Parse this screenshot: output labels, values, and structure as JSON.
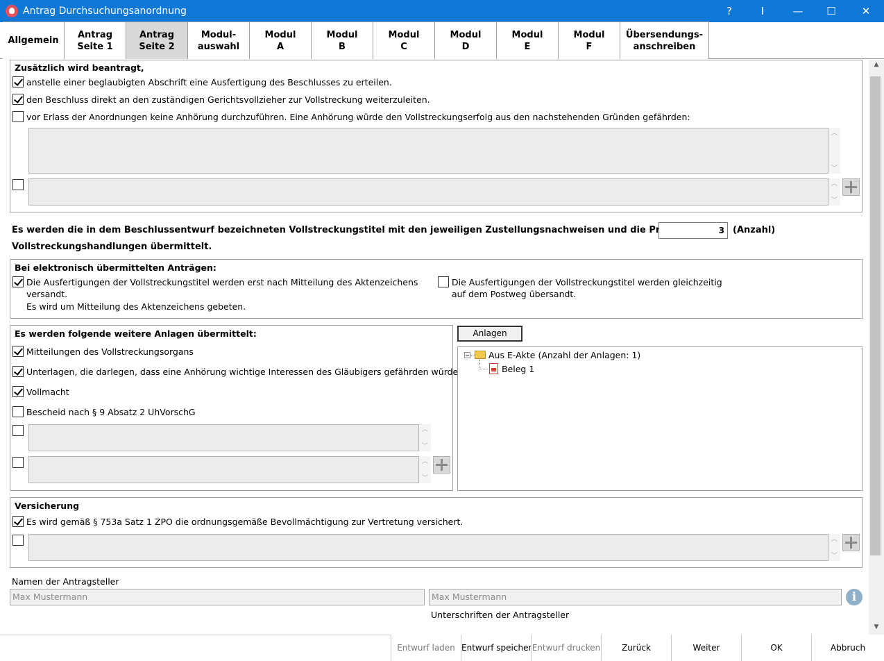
{
  "window": {
    "title": "Antrag Durchsuchungsanordnung",
    "help": "?",
    "pin": "I",
    "minimize": "—",
    "maximize": "☐",
    "close": "✕"
  },
  "tabs": [
    {
      "label": "Allgemein"
    },
    {
      "label": "Antrag\nSeite 1"
    },
    {
      "label": "Antrag\nSeite 2"
    },
    {
      "label": "Modul-\nauswahl"
    },
    {
      "label": "Modul\nA"
    },
    {
      "label": "Modul\nB"
    },
    {
      "label": "Modul\nC"
    },
    {
      "label": "Modul\nD"
    },
    {
      "label": "Modul\nE"
    },
    {
      "label": "Modul\nF"
    },
    {
      "label": "Übersendungs-\nanschreiben"
    }
  ],
  "zusaetzlich": {
    "title": "Zusätzlich wird beantragt,",
    "options": [
      {
        "label": "anstelle einer beglaubigten Abschrift eine Ausfertigung des Beschlusses zu erteilen.",
        "checked": true
      },
      {
        "label": "den Beschluss direkt an den zuständigen Gerichtsvollzieher zur Vollstreckung weiterzuleiten.",
        "checked": true
      },
      {
        "label": "vor Erlass der Anordnungen keine Anhörung durchzuführen. Eine Anhörung würde den Vollstreckungserfolg aus den nachstehenden Gründen gefährden:",
        "checked": false
      }
    ],
    "extra_checked": false
  },
  "titel": {
    "text_before": "Es werden die in dem Beschlussentwurf bezeichneten Vollstreckungstitel mit den jeweiligen Zustellungsnachweisen und die Protokolle über",
    "count": "3",
    "unit": "(Anzahl)",
    "text_after": "Vollstreckungshandlungen  übermittelt."
  },
  "elektronisch": {
    "title": "Bei elektronisch übermittelten Anträgen:",
    "left": {
      "line1": "Die Ausfertigungen der Vollstreckungstitel werden erst nach Mitteilung des Aktenzeichens",
      "line2": "versandt.",
      "line3": "Es wird um Mitteilung des Aktenzeichens gebeten.",
      "checked": true
    },
    "right": {
      "line1": "Die Ausfertigungen der Vollstreckungstitel werden gleichzeitig",
      "line2": "auf dem Postweg übersandt.",
      "checked": false
    }
  },
  "anlagen": {
    "title": "Es werden folgende weitere Anlagen übermittelt:",
    "options": [
      {
        "label": "Mitteilungen des Vollstreckungsorgans",
        "checked": true
      },
      {
        "label": "Unterlagen, die darlegen, dass eine Anhörung wichtige Interessen des Gläubigers gefährden würde",
        "checked": true
      },
      {
        "label": "Vollmacht",
        "checked": true
      },
      {
        "label": "Bescheid nach § 9 Absatz 2 UhVorschG",
        "checked": false
      }
    ],
    "button": "Anlagen",
    "tree_root": "Aus E-Akte (Anzahl der Anlagen: 1)",
    "tree_child": "Beleg 1"
  },
  "versicherung": {
    "title": "Versicherung",
    "option": {
      "label": "Es wird gemäß § 753a Satz 1 ZPO die ordnungsgemäße Bevollmächtigung zur Vertretung versichert.",
      "checked": true
    }
  },
  "namen": {
    "label": "Namen der Antragsteller",
    "value": "Max Mustermann",
    "signature_value": "Max Mustermann",
    "signature_label": "Unterschriften der Antragsteller",
    "info": "i"
  },
  "footer": {
    "entwurf_laden": "Entwurf laden",
    "entwurf_speichern": "Entwurf speichern",
    "entwurf_drucken": "Entwurf drucken",
    "zurueck": "Zurück",
    "weiter": "Weiter",
    "ok": "OK",
    "abbruch": "Abbruch"
  }
}
